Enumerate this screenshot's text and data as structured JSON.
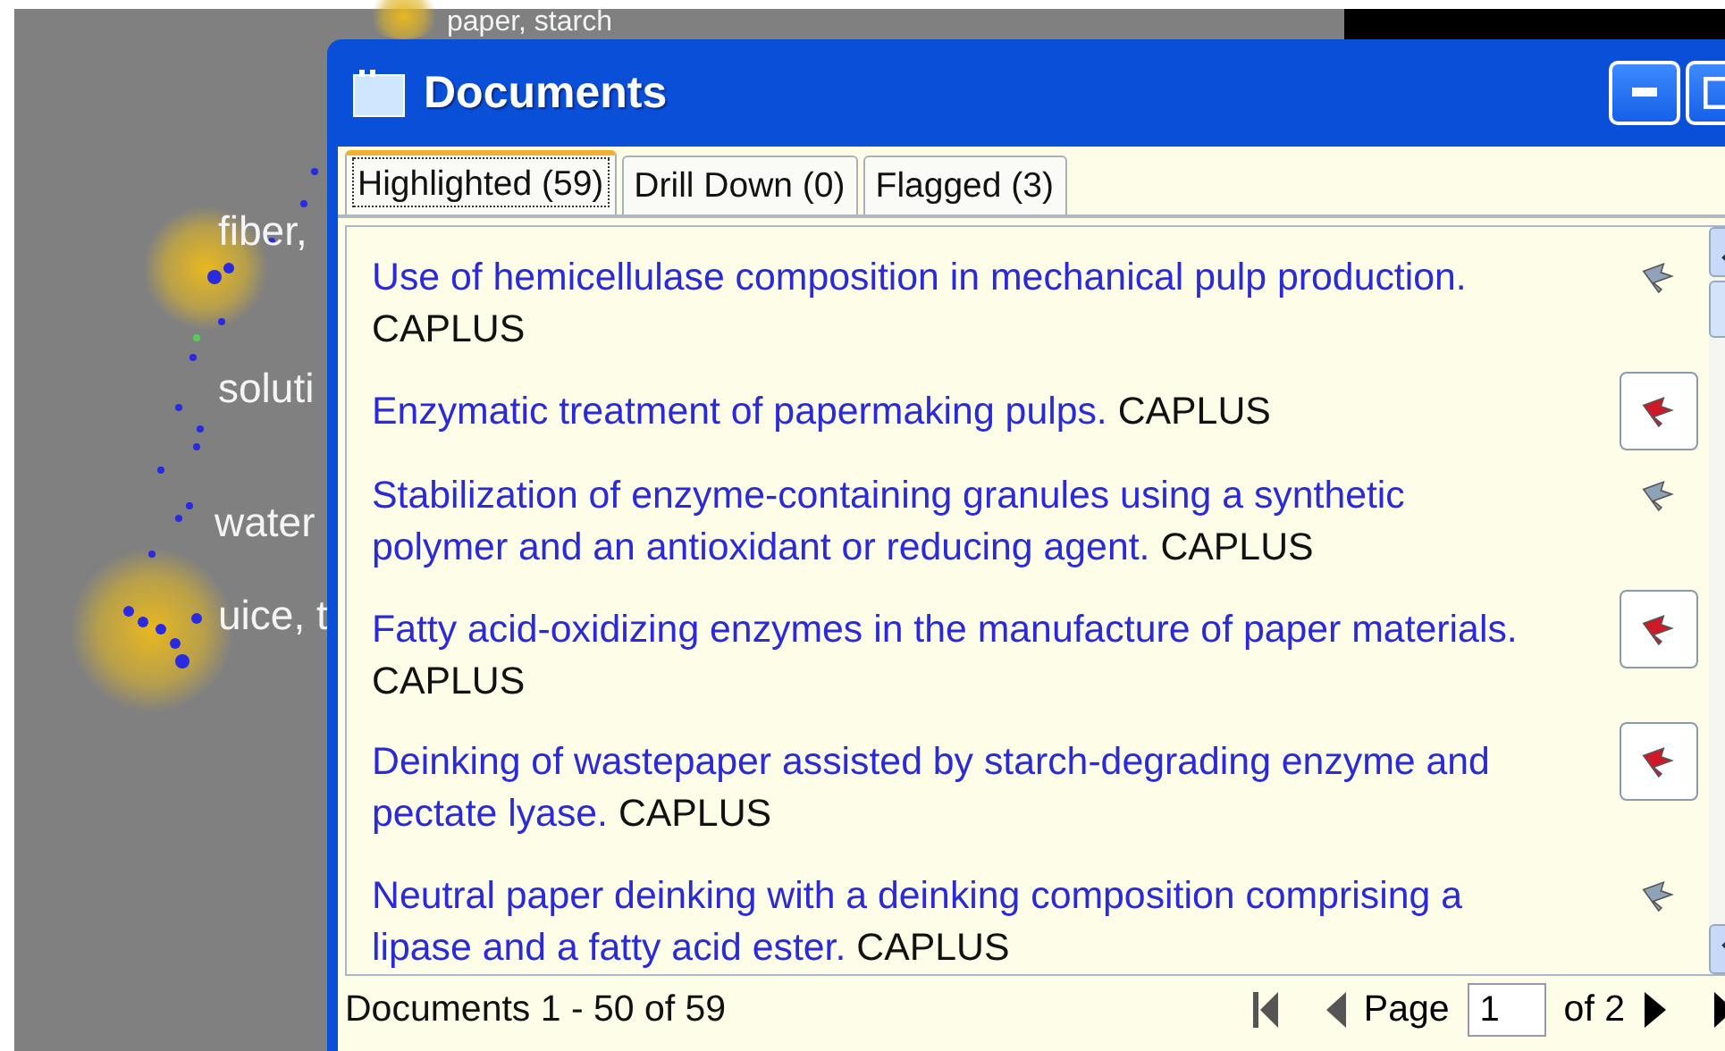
{
  "background_labels": [
    "paper, starch",
    "fiber,",
    "soluti",
    "water",
    "uice, t"
  ],
  "window": {
    "title": "Documents"
  },
  "tabs": [
    {
      "label": "Highlighted (59)",
      "selected": true
    },
    {
      "label": "Drill Down (0)",
      "selected": false
    },
    {
      "label": "Flagged (3)",
      "selected": false
    }
  ],
  "documents": [
    {
      "title": "Use of hemicellulase composition in mechanical pulp production.",
      "source": "CAPLUS",
      "flagged": false
    },
    {
      "title": "Enzymatic treatment of papermaking pulps.",
      "source": "CAPLUS",
      "flagged": true
    },
    {
      "title": "Stabilization of enzyme-containing granules using a synthetic polymer and an antioxidant or reducing agent.",
      "source": "CAPLUS",
      "flagged": false
    },
    {
      "title": "Fatty acid-oxidizing enzymes in the manufacture of paper materials.",
      "source": "CAPLUS",
      "flagged": true
    },
    {
      "title": "Deinking of wastepaper assisted by starch-degrading enzyme and pectate lyase.",
      "source": "CAPLUS",
      "flagged": true
    },
    {
      "title": "Neutral paper deinking with a deinking composition comprising a lipase and a fatty acid ester.",
      "source": "CAPLUS",
      "flagged": false
    }
  ],
  "status": "Documents 1 - 50 of 59",
  "pager": {
    "label": "Page",
    "page": "1",
    "total": "of 2"
  }
}
